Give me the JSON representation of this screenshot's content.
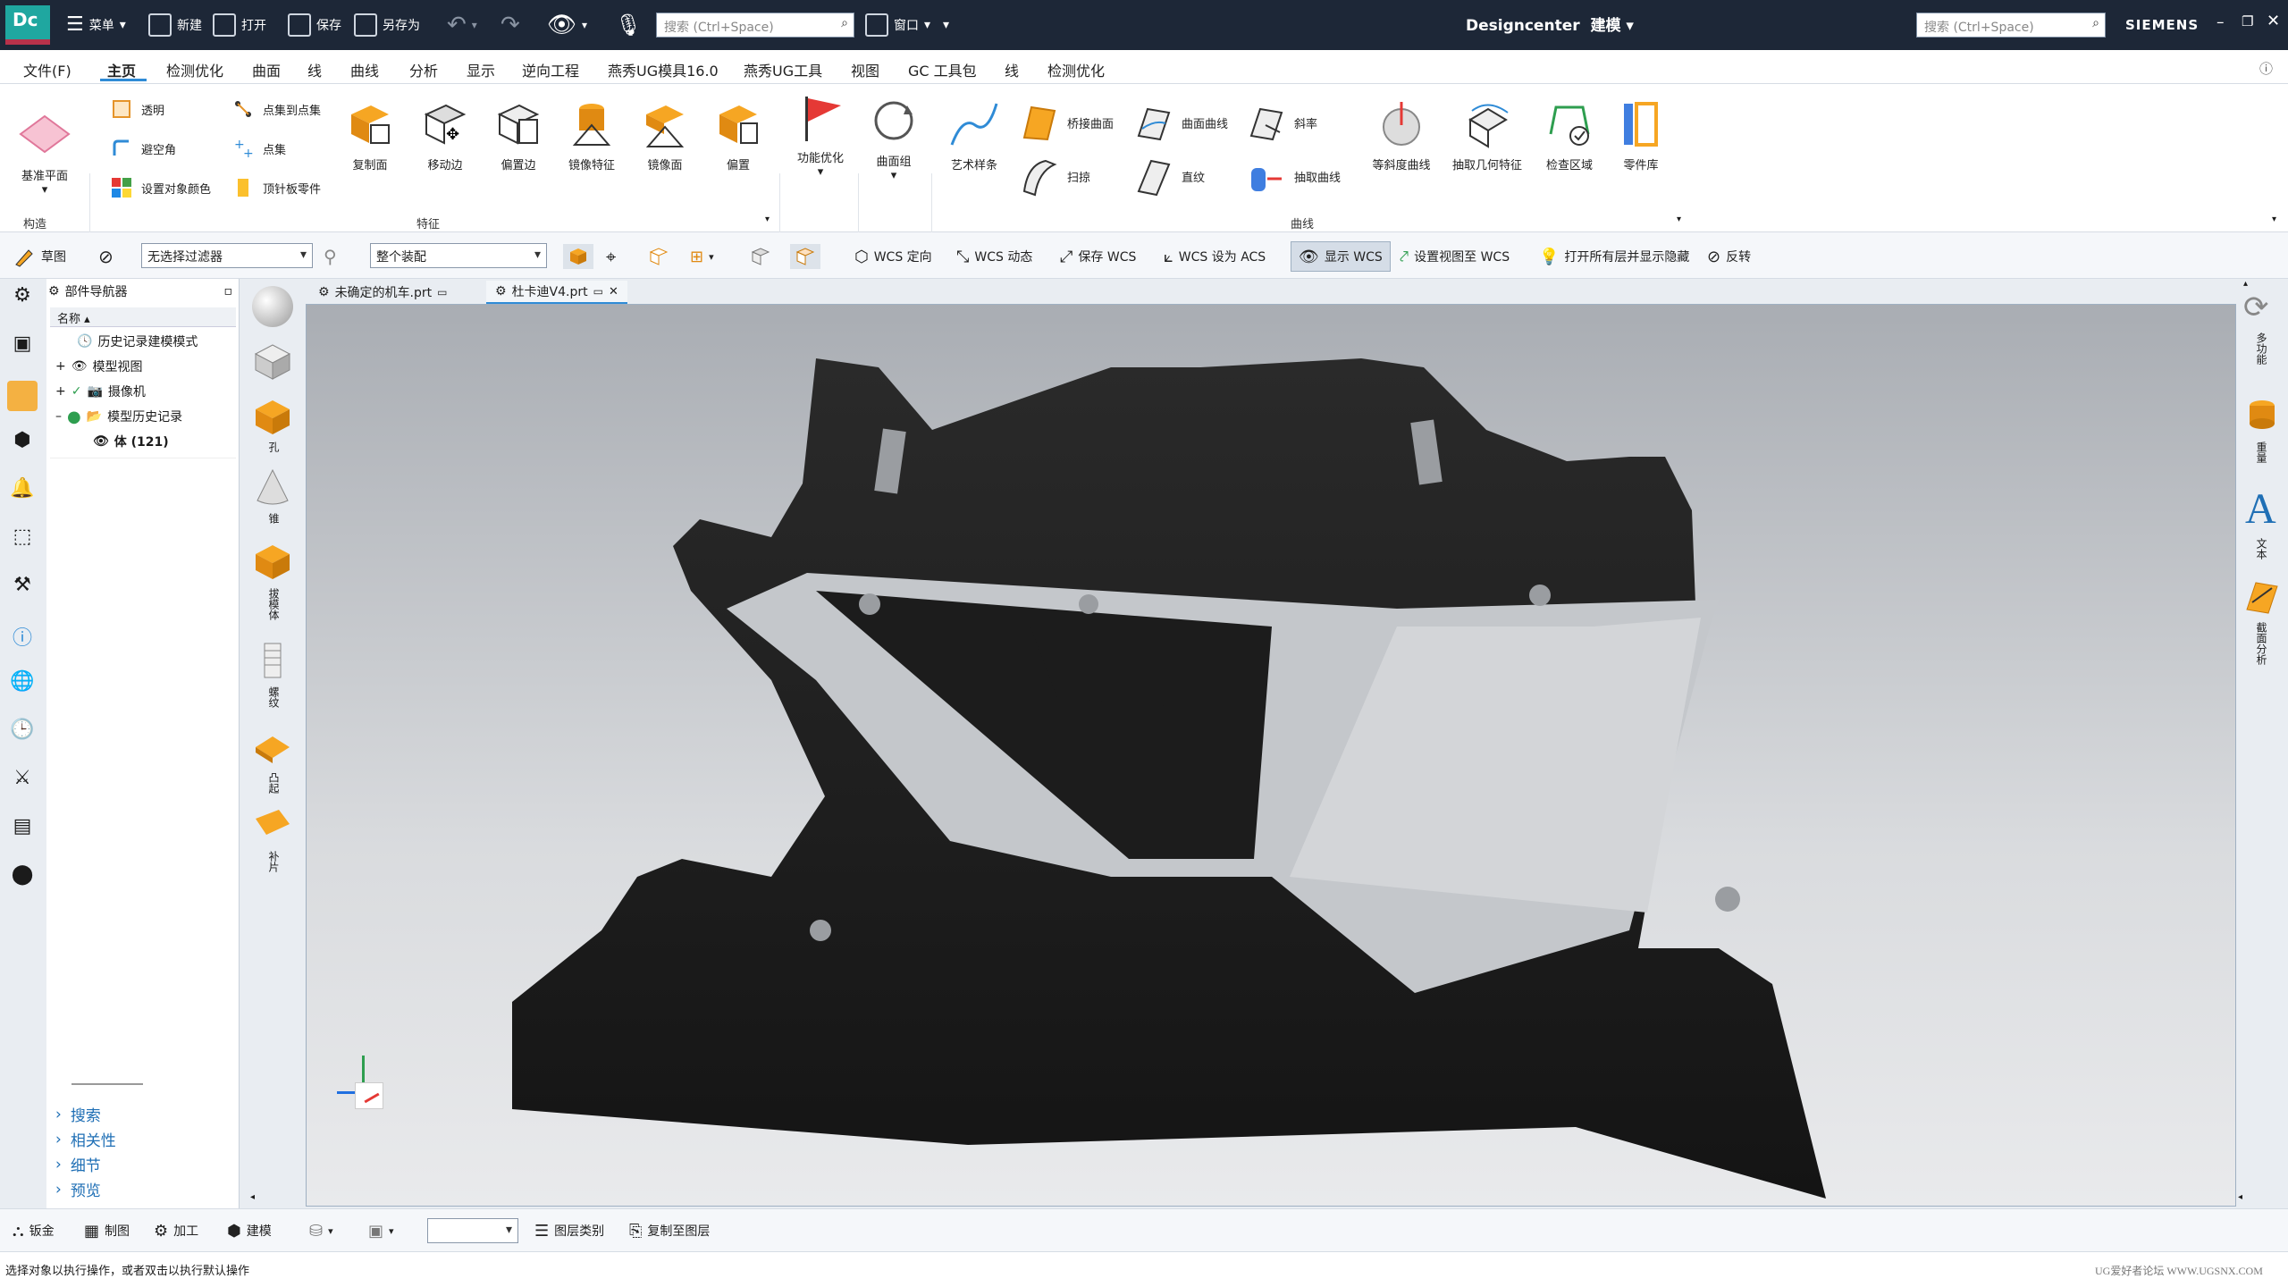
{
  "titlebar": {
    "logo": "Dc",
    "menu_label": "菜单",
    "new_label": "新建",
    "open_label": "打开",
    "save_label": "保存",
    "saveas_label": "另存为",
    "search_placeholder": "搜索 (Ctrl+Space)",
    "window_label": "窗口",
    "app_title": "Designcenter",
    "mode": "建模",
    "search2_placeholder": "搜索 (Ctrl+Space)",
    "brand": "SIEMENS"
  },
  "menubar": {
    "items": [
      "文件(F)",
      "主页",
      "检测优化",
      "曲面",
      "线",
      "曲线",
      "分析",
      "显示",
      "逆向工程",
      "燕秀UG模具16.0",
      "燕秀UG工具",
      "视图",
      "GC 工具包",
      "线",
      "检测优化"
    ],
    "active": "主页"
  },
  "ribbon": {
    "base_plane": "基准平面",
    "construct_label": "构造",
    "transparent": "透明",
    "avoid_corner": "避空角",
    "set_color": "设置对象颜色",
    "point_to_set": "点集到点集",
    "point_set": "点集",
    "ejector_part": "顶针板零件",
    "copy_face": "复制面",
    "move_edge": "移动边",
    "offset_edge": "偏置边",
    "mirror_feature": "镜像特征",
    "mirror_face": "镜像面",
    "offset": "偏置",
    "feature_label": "特征",
    "func_opt": "功能优化",
    "face_group": "曲面组",
    "art_spline": "艺术样条",
    "bridge_surface": "桥接曲面",
    "sweep": "扫掠",
    "surface_curve": "曲面曲线",
    "ruled": "直纹",
    "slope": "斜率",
    "extract_curve": "抽取曲线",
    "isocline": "等斜度曲线",
    "extract_geom": "抽取几何特征",
    "check_region": "检查区域",
    "part_library": "零件库",
    "curve_label": "曲线"
  },
  "toolbar2": {
    "sketch": "草图",
    "filter": "无选择过滤器",
    "assembly": "整个装配",
    "wcs_orient": "WCS 定向",
    "wcs_dynamic": "WCS 动态",
    "save_wcs": "保存 WCS",
    "wcs_acs": "WCS 设为 ACS",
    "show_wcs": "显示 WCS",
    "view_to_wcs": "设置视图至 WCS",
    "open_layers": "打开所有层并显示隐藏",
    "invert": "反转"
  },
  "navigator": {
    "title": "部件导航器",
    "column": "名称",
    "rows": [
      "历史记录建模模式",
      "模型视图",
      "摄像机",
      "模型历史记录",
      "体 (121)"
    ],
    "sections": [
      "搜索",
      "相关性",
      "细节",
      "预览"
    ]
  },
  "featstrip": {
    "labels": [
      "孔",
      "锥",
      "拔模体",
      "螺纹",
      "凸起",
      "补片"
    ]
  },
  "tabs": [
    {
      "label": "未确定的机车.prt"
    },
    {
      "label": "杜卡迪V4.prt"
    }
  ],
  "rightrail": {
    "labels": [
      "多功能",
      "重量",
      "文本",
      "截面分析"
    ]
  },
  "bottombar": {
    "sheet_metal": "钣金",
    "drafting": "制图",
    "machining": "加工",
    "modeling": "建模",
    "layer_category": "图层类别",
    "copy_to_layer": "复制至图层"
  },
  "status": {
    "message": "选择对象以执行操作，或者双击以执行默认操作",
    "watermark": "UG爱好者论坛 WWW.UGSNX.COM"
  },
  "colors": {
    "titlebar": "#1d2737",
    "accent": "#2f8bd6",
    "logo": "#1fa7a0"
  }
}
